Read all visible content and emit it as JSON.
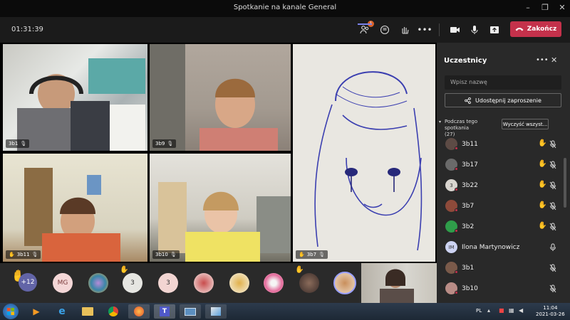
{
  "window": {
    "title": "Spotkanie na kanale General"
  },
  "toolbar": {
    "timer": "01:31:39",
    "participants_badge": "1",
    "end_label": "Zakończ"
  },
  "stage": {
    "tiles": [
      {
        "name": "3b1"
      },
      {
        "name": "3b9"
      },
      {
        "name": "3b7"
      },
      {
        "name": "3b11"
      },
      {
        "name": "3b10"
      }
    ]
  },
  "bottom": {
    "overflow_count": "+12",
    "avatars": [
      "MG",
      "3",
      "3"
    ]
  },
  "panel": {
    "title": "Uczestnicy",
    "search_placeholder": "Wpisz nazwę",
    "share_label": "Udostępnij zaproszenie",
    "section_label": "Podczas tego spotkania",
    "section_count": "(27)",
    "clear_label": "Wyczyść wszyst...",
    "participants": [
      {
        "name": "3b11",
        "avatar": "",
        "hand": true
      },
      {
        "name": "3b17",
        "avatar": "",
        "hand": true
      },
      {
        "name": "3b22",
        "avatar": "3",
        "hand": true
      },
      {
        "name": "3b7",
        "avatar": "",
        "hand": true
      },
      {
        "name": "3b2",
        "avatar": "",
        "hand": true
      },
      {
        "name": "Ilona Martynowicz",
        "avatar": "IM",
        "hand": false
      },
      {
        "name": "3b1",
        "avatar": "",
        "hand": false
      },
      {
        "name": "3b10",
        "avatar": "",
        "hand": false
      }
    ]
  },
  "taskbar": {
    "lang": "PL",
    "time": "11:04",
    "date": "2021-03-26"
  }
}
